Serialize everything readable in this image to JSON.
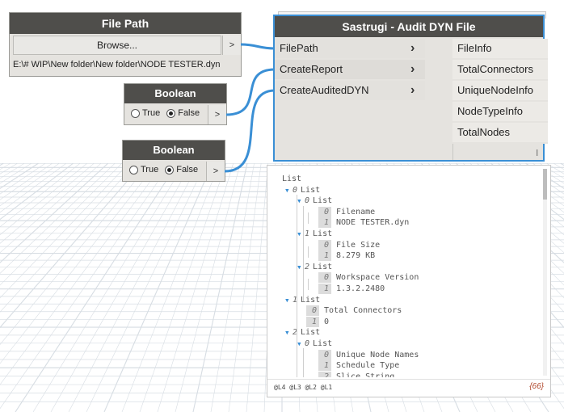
{
  "filepath_node": {
    "title": "File Path",
    "browse_label": "Browse...",
    "output_port": ">",
    "value": "E:\\# WIP\\New folder\\New folder\\NODE TESTER.dyn"
  },
  "boolean_nodes": [
    {
      "title": "Boolean",
      "true_label": "True",
      "false_label": "False",
      "selected": "False",
      "output_port": ">"
    },
    {
      "title": "Boolean",
      "true_label": "True",
      "false_label": "False",
      "selected": "False",
      "output_port": ">"
    }
  ],
  "main_node": {
    "title": "Sastrugi - Audit DYN File",
    "inputs": [
      "FilePath",
      "CreateReport",
      "CreateAuditedDYN"
    ],
    "outputs": [
      "FileInfo",
      "TotalConnectors",
      "UniqueNodeInfo",
      "NodeTypeInfo",
      "TotalNodes"
    ],
    "lacing": "l"
  },
  "watch": {
    "lines": [
      {
        "indent": 0,
        "tri": false,
        "index": "",
        "text": "List"
      },
      {
        "indent": 1,
        "tri": true,
        "index": "0",
        "text": "List"
      },
      {
        "indent": 2,
        "tri": true,
        "index": "0",
        "text": "List"
      },
      {
        "indent": 3,
        "tri": false,
        "index": "0",
        "text": "Filename"
      },
      {
        "indent": 3,
        "tri": false,
        "index": "1",
        "text": "NODE TESTER.dyn"
      },
      {
        "indent": 2,
        "tri": true,
        "index": "1",
        "text": "List"
      },
      {
        "indent": 3,
        "tri": false,
        "index": "0",
        "text": "File Size"
      },
      {
        "indent": 3,
        "tri": false,
        "index": "1",
        "text": "8.279 KB"
      },
      {
        "indent": 2,
        "tri": true,
        "index": "2",
        "text": "List"
      },
      {
        "indent": 3,
        "tri": false,
        "index": "0",
        "text": "Workspace Version"
      },
      {
        "indent": 3,
        "tri": false,
        "index": "1",
        "text": "1.3.2.2480"
      },
      {
        "indent": 1,
        "tri": true,
        "index": "1",
        "text": "List"
      },
      {
        "indent": 2,
        "tri": false,
        "index": "0",
        "text": "Total Connectors"
      },
      {
        "indent": 2,
        "tri": false,
        "index": "1",
        "text": "0"
      },
      {
        "indent": 1,
        "tri": true,
        "index": "2",
        "text": "List"
      },
      {
        "indent": 2,
        "tri": true,
        "index": "0",
        "text": "List"
      },
      {
        "indent": 3,
        "tri": false,
        "index": "0",
        "text": "Unique Node Names"
      },
      {
        "indent": 3,
        "tri": false,
        "index": "1",
        "text": "Schedule Type"
      },
      {
        "indent": 3,
        "tri": false,
        "index": "2",
        "text": "Slice String"
      }
    ],
    "levels": "@L4 @L3 @L2 @L1",
    "count": "{66}"
  },
  "colors": {
    "wire": "#3a8fd5",
    "header": "#4f4e4b",
    "node_body": "#e5e3df",
    "grid": "#d7dde3"
  }
}
